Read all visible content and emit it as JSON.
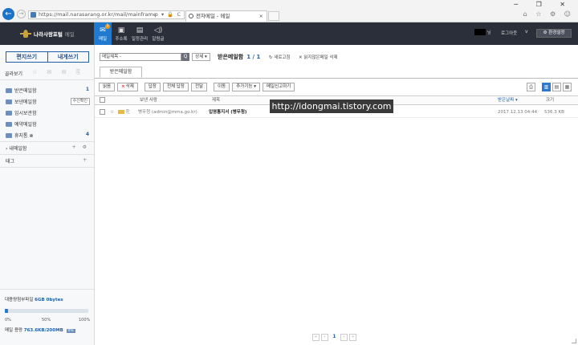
{
  "browser": {
    "url": "https://mail.narasarang.or.kr/mail/mainframe",
    "url_controls": "ρ ▾ 🔒 C",
    "tab_title": "전자메일 - 메일",
    "window_controls": "─ ❐ ✕",
    "toolbar_icons": "⌂ ☆ ⚙ ☺"
  },
  "topbar": {
    "logo": "나라사랑포털",
    "logo_sub": "메일",
    "nav": [
      {
        "label": "메일",
        "icon": "✉",
        "badge": "1"
      },
      {
        "label": "주소록",
        "icon": "▣"
      },
      {
        "label": "일정관리",
        "icon": "▤"
      },
      {
        "label": "알림글",
        "icon": "◁)"
      }
    ],
    "user_suffix": "님",
    "logout": "로그아웃",
    "chevron": "v",
    "settings": "⚙ 환경설정"
  },
  "sidebar": {
    "compose": "편지쓰기",
    "write_self": "내게쓰기",
    "quick_view": "골라보기",
    "quick_icons": "☆ ✉ ✉ ⎘",
    "folders": [
      {
        "label": "받은메일함",
        "count": "1"
      },
      {
        "label": "보낸메일함",
        "action": "수신확인"
      },
      {
        "label": "임시보관함"
      },
      {
        "label": "예약메일함"
      },
      {
        "label": "휴지통 ⊗",
        "count": "4"
      }
    ],
    "my_folder": "내메일함",
    "my_folder_ctl": "+ ⚙",
    "tag": "태그",
    "tag_ctl": "+",
    "quota": {
      "label": "대용량첨부파일",
      "size": "6GB 0bytes",
      "used_fraction": 0.04,
      "ticks": [
        "0%",
        "50%",
        "100%"
      ],
      "used_label": "메일 용량",
      "used_value": "763.6KB/200MB",
      "used_tag": "0%"
    }
  },
  "main": {
    "search_select": "메일제목 -",
    "search_icon": "Q",
    "detail": "상세 ▾",
    "box_title": "받은메일함",
    "box_count": "1 / 1",
    "refresh": "↻ 새로고침",
    "delete_all": "✕ 읽지않은메일 삭제",
    "tab": "받은메일함",
    "toolbar": [
      "읽음",
      "삭제",
      "답장",
      "전체 답장",
      "전달",
      "이동",
      "추가기능 ▾",
      "메일신고하기"
    ],
    "delete_x": "×",
    "view_icons": [
      "⎙",
      "▥",
      "▤",
      "▦"
    ],
    "columns": {
      "sender": "보낸 사람",
      "subject": "제목",
      "date": "받은날짜 ▾",
      "size": "크기"
    },
    "rows": [
      {
        "flags": "☆",
        "sender": "병무청 (admin@mma.go.kr)",
        "subject": "입영통지서 (병무청)",
        "date": "2017.12.13 04:44",
        "size": "536.3 KB"
      }
    ],
    "watermark": "http://idongmai.tistory.com",
    "pager": [
      "«",
      "‹",
      "1",
      "›",
      "»"
    ]
  }
}
